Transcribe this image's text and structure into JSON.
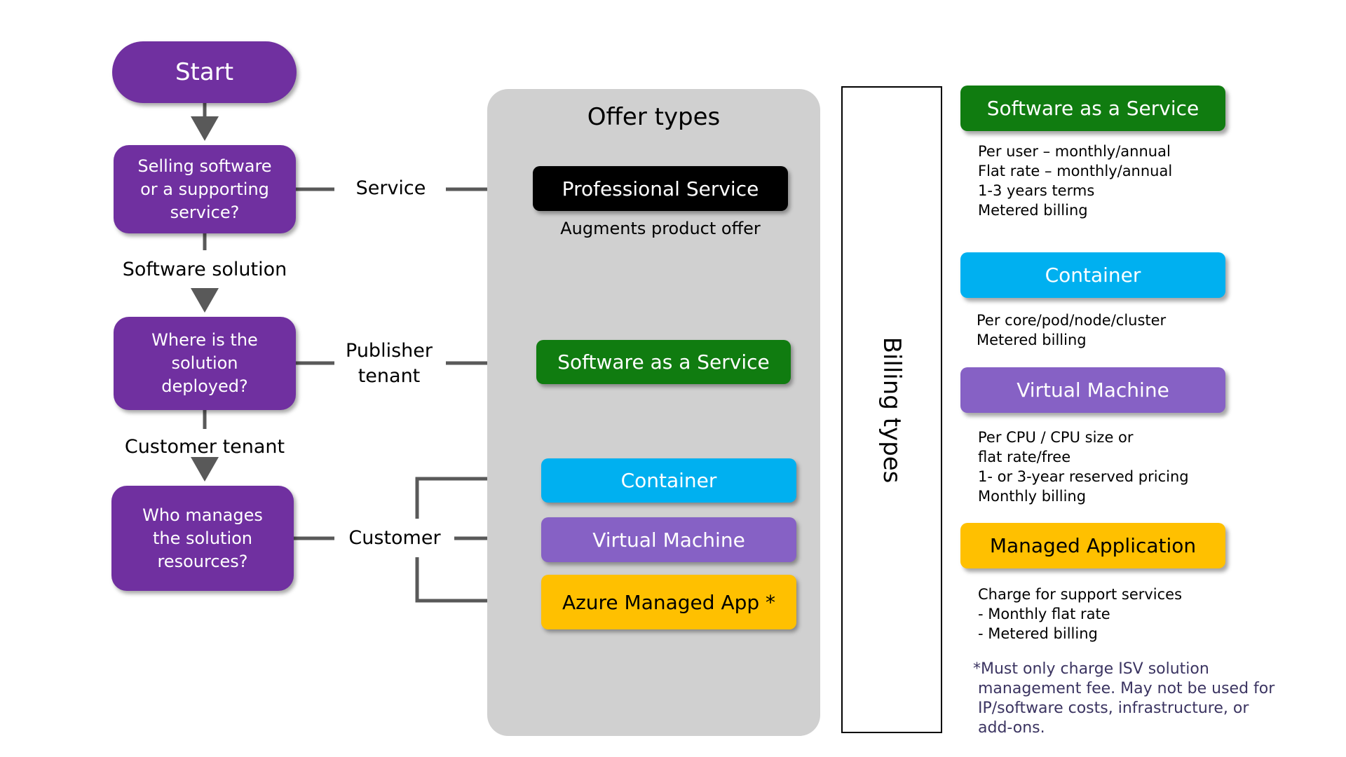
{
  "flow": {
    "start": "Start",
    "questions": [
      "Selling software\nor a supporting\nservice?",
      "Where is the\nsolution\ndeployed?",
      "Who manages\nthe solution\nresources?"
    ],
    "answers": {
      "service": "Service",
      "software_solution": "Software solution",
      "publisher_tenant": "Publisher\ntenant",
      "customer_tenant": "Customer tenant",
      "customer": "Customer"
    }
  },
  "offer_types": {
    "title": "Offer types",
    "items": [
      {
        "label": "Professional Service",
        "color": "#000000",
        "text_color": "#ffffff",
        "note": "Augments product offer"
      },
      {
        "label": "Software as a Service",
        "color": "#107C10",
        "text_color": "#ffffff"
      },
      {
        "label": "Container",
        "color": "#00B0F0",
        "text_color": "#ffffff"
      },
      {
        "label": "Virtual Machine",
        "color": "#8661C5",
        "text_color": "#ffffff"
      },
      {
        "label": "Azure Managed App *",
        "color": "#FFC000",
        "text_color": "#000000"
      }
    ]
  },
  "billing_types": {
    "title": "Billing types",
    "items": [
      {
        "label": "Software as a Service",
        "color": "#107C10",
        "text_color": "#ffffff",
        "details": [
          "Per user – monthly/annual",
          "Flat rate – monthly/annual",
          "1-3 years terms",
          "Metered billing"
        ]
      },
      {
        "label": "Container",
        "color": "#00B0F0",
        "text_color": "#ffffff",
        "details": [
          "Per core/pod/node/cluster",
          "Metered billing"
        ]
      },
      {
        "label": "Virtual Machine",
        "color": "#8661C5",
        "text_color": "#ffffff",
        "details": [
          "Per CPU / CPU size or",
          "flat rate/free",
          "1- or 3-year reserved pricing",
          "Monthly billing"
        ]
      },
      {
        "label": "Managed Application",
        "color": "#FFC000",
        "text_color": "#000000",
        "details": [
          "Charge for support services",
          "- Monthly flat rate",
          "- Metered billing"
        ]
      }
    ],
    "footnote": "*Must only charge ISV solution\n management fee. May not be used for\n IP/software costs, infrastructure, or\n add-ons."
  },
  "colors": {
    "decision": "#7030A0",
    "connector": "#595959",
    "panel": "#D0D0D0",
    "footnote": "#3B3461"
  }
}
